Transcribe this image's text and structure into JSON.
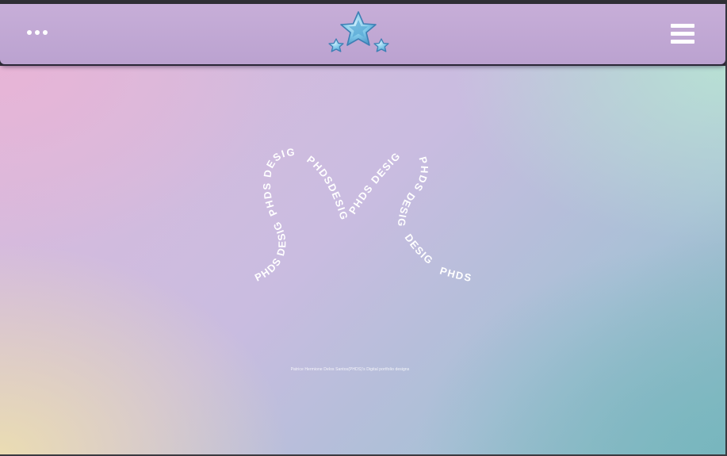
{
  "header": {
    "menu_more_icon": "more-horizontal-icon",
    "logo_icon": "three-stars-logo-icon",
    "hamburger_icon": "hamburger-menu-icon",
    "colors": {
      "bar": "#bfa7d4",
      "star": "#7cc6e8",
      "star_outline": "#3e7fb4"
    }
  },
  "hero": {
    "monogram_segments": [
      "PHDS DESIGN",
      "PHDS DESIGN",
      "PHDSDESIGN",
      "PHDS DESIGN",
      "PHDS DESIGN",
      "DESIGN",
      "PHDS"
    ],
    "caption": "Patrice Hermione Delos Santos(PHDS)'s Digital portfolio designs"
  }
}
